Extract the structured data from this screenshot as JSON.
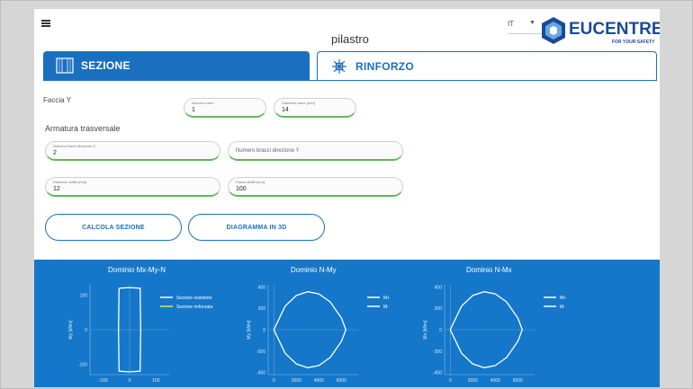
{
  "header": {
    "title": "pilastro",
    "language": "IT",
    "logo_text": "EUCENTRE",
    "logo_tagline": "FOR YOUR SAFETY"
  },
  "tabs": [
    {
      "label": "SEZIONE",
      "icon": "section-grid-icon",
      "active": true
    },
    {
      "label": "RINFORZO",
      "icon": "reinforcement-snowflake-icon",
      "active": false
    }
  ],
  "form": {
    "faccia_label": "Faccia Y",
    "numero_barre": {
      "label": "Numero barre",
      "value": "1"
    },
    "diametro_barre": {
      "label": "Diametro barre [mm]",
      "value": "14"
    },
    "armatura_label": "Armatura trasversale",
    "bracci_x": {
      "label": "Numero bracci direzione X",
      "value": "2"
    },
    "bracci_y": {
      "placeholder": "Numero bracci direzione Y"
    },
    "diametro_staffe": {
      "label": "Diametro staffe [mm]",
      "value": "12"
    },
    "passo_staffe": {
      "label": "Passo staffe [mm]",
      "value": "100"
    }
  },
  "buttons": {
    "calcola": "CALCOLA SEZIONE",
    "diagramma": "DIAGRAMMA IN 3D"
  },
  "colors": {
    "accent": "#1a6fc0",
    "plot_bg": "#1577c9",
    "field_underline": "#5cb85c"
  },
  "chart_data": [
    {
      "type": "line",
      "title": "Dominio Mx-My-N",
      "ylabel": "My [kNm]",
      "xticks": [
        "-100",
        "0",
        "100"
      ],
      "yticks": [
        "100",
        "0",
        "-100"
      ],
      "xlim": [
        -150,
        150
      ],
      "ylim": [
        -130,
        130
      ],
      "series": [
        {
          "name": "Sezione esistente",
          "color": "#ffffff",
          "x": [
            -40,
            0,
            40,
            42,
            40,
            0,
            -40,
            -42,
            -40
          ],
          "y": [
            120,
            122,
            120,
            0,
            -120,
            -122,
            -120,
            0,
            120
          ]
        },
        {
          "name": "Sezione rinforzata",
          "color": "#d9e85a",
          "x": [],
          "y": []
        }
      ]
    },
    {
      "type": "line",
      "title": "Dominio N-My",
      "ylabel": "My [kNm]",
      "xticks": [
        "0",
        "2000",
        "4000",
        "6000"
      ],
      "yticks": [
        "400",
        "200",
        "0",
        "-200",
        "-400"
      ],
      "xlim": [
        -500,
        7500
      ],
      "ylim": [
        -420,
        420
      ],
      "series": [
        {
          "name": "M+",
          "color": "#ffffff",
          "x": [
            0,
            1000,
            2000,
            3000,
            4000,
            5000,
            6000,
            6400
          ],
          "y": [
            0,
            220,
            320,
            355,
            335,
            260,
            110,
            0
          ]
        },
        {
          "name": "M-",
          "color": "#ffffff",
          "x": [
            0,
            1000,
            2000,
            3000,
            4000,
            5000,
            6000,
            6400
          ],
          "y": [
            0,
            -220,
            -320,
            -355,
            -335,
            -260,
            -110,
            0
          ]
        }
      ]
    },
    {
      "type": "line",
      "title": "Dominio N-Mx",
      "ylabel": "Mx [kNm]",
      "xticks": [
        "0",
        "2000",
        "4000",
        "6000"
      ],
      "yticks": [
        "400",
        "200",
        "0",
        "-200",
        "-400"
      ],
      "xlim": [
        -500,
        7500
      ],
      "ylim": [
        -420,
        420
      ],
      "series": [
        {
          "name": "M+",
          "color": "#ffffff",
          "x": [
            0,
            1000,
            2000,
            3000,
            4000,
            5000,
            6000,
            6400
          ],
          "y": [
            0,
            220,
            320,
            355,
            335,
            260,
            110,
            0
          ]
        },
        {
          "name": "M-",
          "color": "#ffffff",
          "x": [
            0,
            1000,
            2000,
            3000,
            4000,
            5000,
            6000,
            6400
          ],
          "y": [
            0,
            -220,
            -320,
            -355,
            -335,
            -260,
            -110,
            0
          ]
        }
      ]
    }
  ]
}
